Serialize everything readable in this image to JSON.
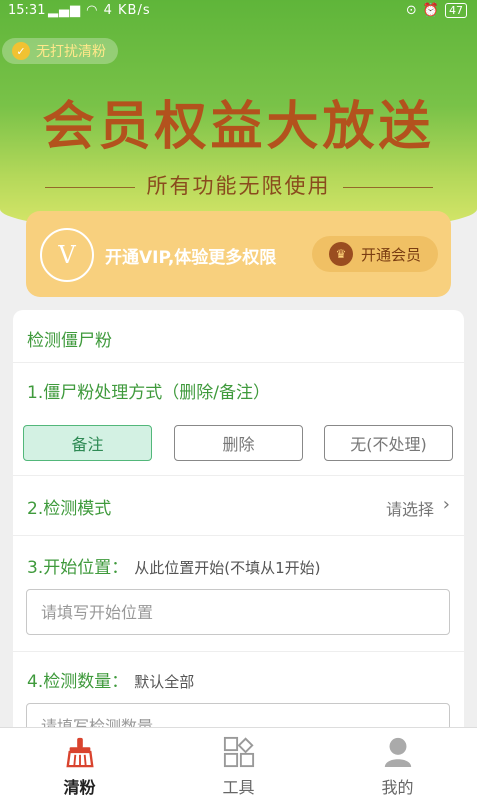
{
  "status_bar": {
    "time": "15:31",
    "network": "4 KB/s",
    "battery": "47"
  },
  "hero": {
    "pill": "无打扰清粉",
    "title": "会员权益大放送",
    "subtitle": "所有功能无限使用"
  },
  "vip": {
    "logo": "V",
    "text": "开通VIP,体验更多权限",
    "button": "开通会员"
  },
  "panel": {
    "header": "检测僵尸粉",
    "section1": {
      "title": "1.僵尸粉处理方式（删除/备注）",
      "options": [
        "备注",
        "删除",
        "无(不处理)"
      ],
      "selected": "备注"
    },
    "section2": {
      "title": "2.检测模式",
      "value": "请选择"
    },
    "section3": {
      "title": "3.开始位置：",
      "hint": "从此位置开始(不填从1开始)",
      "placeholder": "请填写开始位置"
    },
    "section4": {
      "title": "4.检测数量：",
      "hint": "默认全部",
      "placeholder": "请填写检测数量"
    }
  },
  "tabs": [
    {
      "label": "清粉",
      "icon": "broom-icon",
      "active": true
    },
    {
      "label": "工具",
      "icon": "grid-icon",
      "active": false
    },
    {
      "label": "我的",
      "icon": "user-icon",
      "active": false
    }
  ],
  "colors": {
    "accent_green": "#3f9a3c",
    "hero_title": "#b3521d",
    "vip_card": "#f8d07e",
    "active_tab_icon": "#d9432e"
  }
}
